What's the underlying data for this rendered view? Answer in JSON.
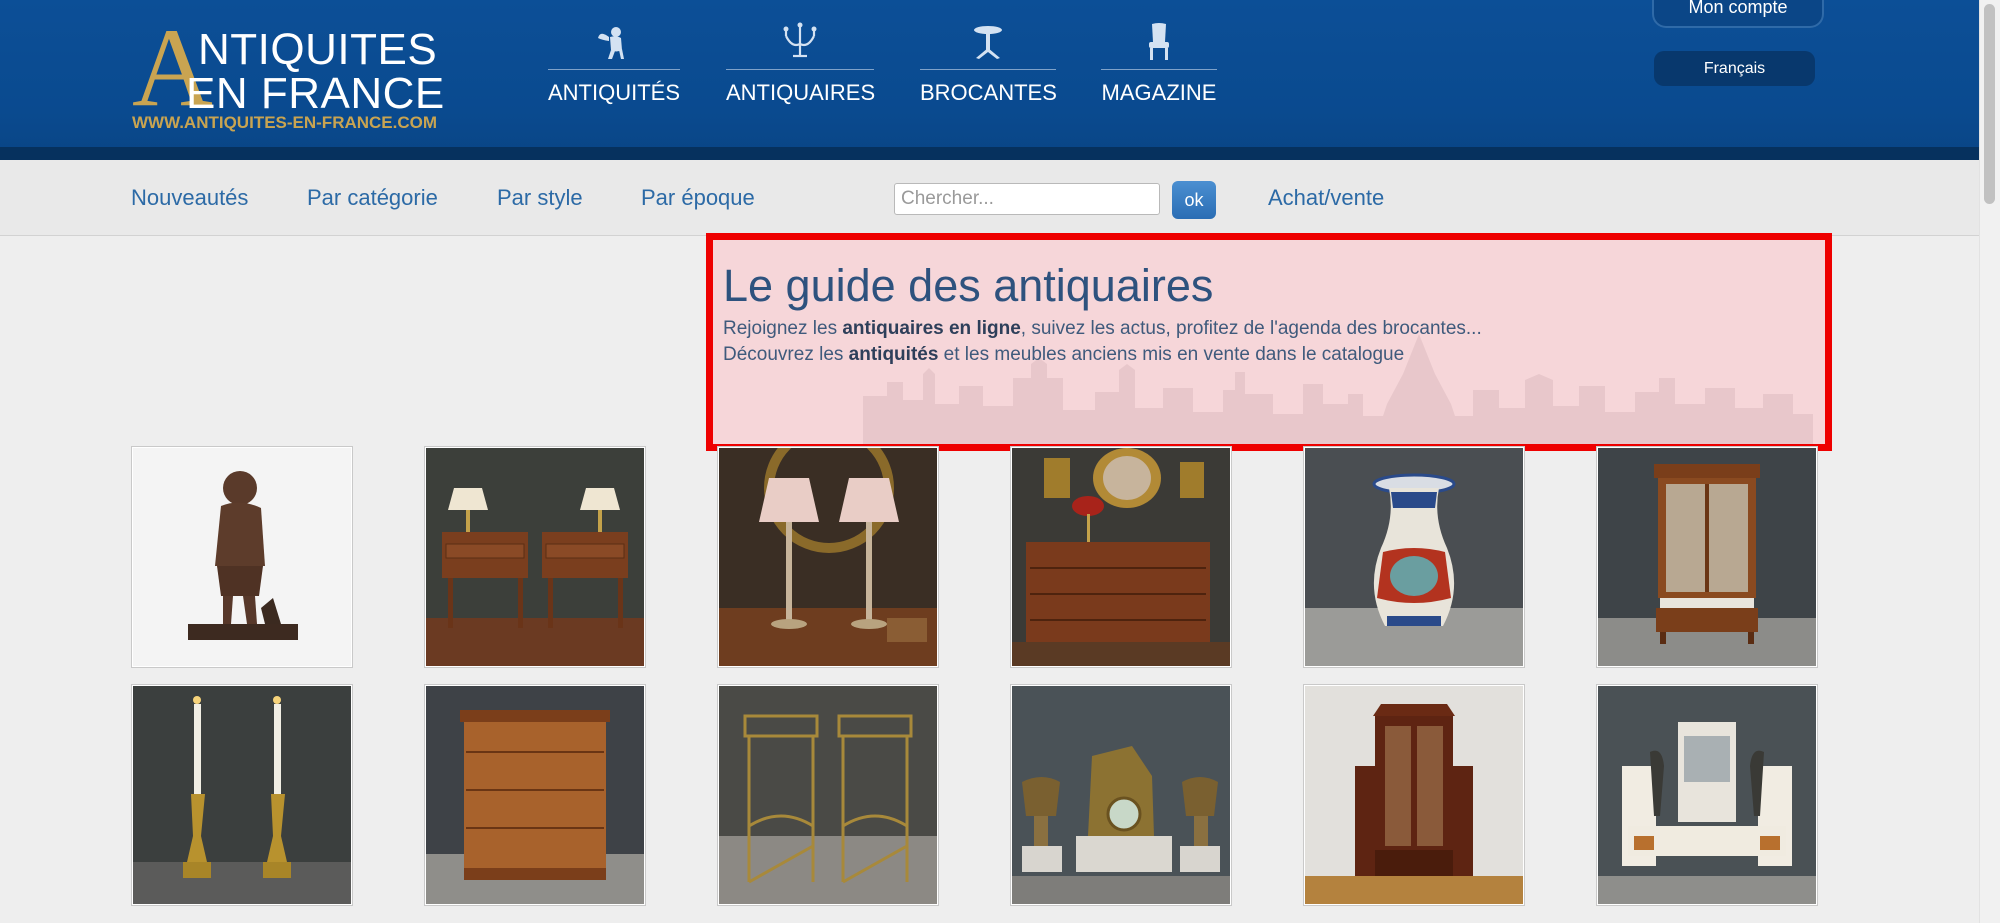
{
  "header": {
    "logo": {
      "letter": "A",
      "line1": "NTIQUITES",
      "line2": "EN FRANCE",
      "url": "WWW.ANTIQUITES-EN-FRANCE.COM"
    },
    "nav": [
      {
        "label": "ANTIQUITÉS",
        "icon": "cherub-icon"
      },
      {
        "label": "ANTIQUAIRES",
        "icon": "candelabra-icon"
      },
      {
        "label": "BROCANTES",
        "icon": "table-icon"
      },
      {
        "label": "MAGAZINE",
        "icon": "chair-icon"
      }
    ],
    "account_label": "Mon compte",
    "language_label": "Français"
  },
  "subnav": {
    "links": [
      "Nouveautés",
      "Par catégorie",
      "Par style",
      "Par époque"
    ],
    "search_placeholder": "Chercher...",
    "search_button": "ok",
    "buy_sell": "Achat/vente"
  },
  "guide": {
    "title": "Le guide des antiquaires",
    "line1_pre": "Rejoignez les ",
    "line1_bold": "antiquaires en ligne",
    "line1_post": ", suivez les actus, profitez de l'agenda des brocantes...",
    "line2_pre": "Découvrez les ",
    "line2_bold": "antiquités",
    "line2_post": " et les meubles anciens mis en vente dans le catalogue"
  },
  "products": [
    {
      "subject": "bronze-statue"
    },
    {
      "subject": "pair-of-bedside-tables"
    },
    {
      "subject": "pair-of-table-lamps"
    },
    {
      "subject": "chest-of-drawers-with-portrait"
    },
    {
      "subject": "imari-vase"
    },
    {
      "subject": "display-cabinet"
    },
    {
      "subject": "pair-of-candlesticks"
    },
    {
      "subject": "chest-of-drawers"
    },
    {
      "subject": "pair-of-side-tables"
    },
    {
      "subject": "clock-garniture"
    },
    {
      "subject": "tall-bookcase"
    },
    {
      "subject": "art-deco-clock-set"
    }
  ],
  "colors": {
    "header_blue": "#0c4f97",
    "gold": "#c9a451",
    "link_blue": "#2c6aa6",
    "guide_border": "#ee0000",
    "guide_title": "#2e527e"
  }
}
